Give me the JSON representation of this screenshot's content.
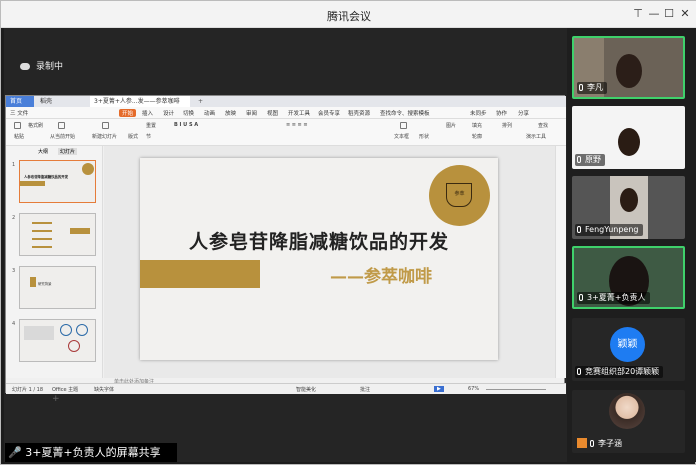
{
  "app": {
    "title": "腾讯会议"
  },
  "recording": {
    "label": "录制中"
  },
  "share_banner": {
    "label": "3+夏菁+负责人的屏幕共享"
  },
  "ppt": {
    "tabs": [
      "首页",
      "稻壳",
      "3+夏菁+人参...发——参萃咖啡"
    ],
    "menu": [
      "三 文件",
      "开始",
      "插入",
      "设计",
      "切换",
      "动画",
      "放映",
      "审阅",
      "视图",
      "开发工具",
      "会员专享",
      "稻壳资源",
      "查找命令、搜索模板",
      "未同步",
      "协作",
      "分享"
    ],
    "ribbon": [
      "格式刷",
      "粘贴",
      "从当前开始",
      "新建幻灯片",
      "版式",
      "节",
      "重置",
      "文本框",
      "形状",
      "图片",
      "填充",
      "轮廓",
      "排列",
      "演示工具",
      "查找",
      "替换"
    ],
    "thumb_tabs": [
      "大纲",
      "幻灯片"
    ],
    "thumbs": [
      {
        "num": "1",
        "text": "人参皂苷降脂减糖饮品的开发"
      },
      {
        "num": "2",
        "text": ""
      },
      {
        "num": "3",
        "text": "研究背景"
      },
      {
        "num": "4",
        "text": ""
      }
    ],
    "slide": {
      "title": "人参皂苷降脂减糖饮品的开发",
      "subtitle": "——参萃咖啡",
      "logo_label": "参萃"
    },
    "notes": "单击此处添加备注",
    "status": {
      "page": "幻灯片 1 / 18",
      "theme": "Office 主题",
      "font": "缺失字体",
      "notes": "智能美化",
      "comment": "批注",
      "zoom": "67%"
    }
  },
  "participants": [
    {
      "name": "李凡",
      "active": true,
      "kind": "video"
    },
    {
      "name": "原野",
      "active": false,
      "kind": "video"
    },
    {
      "name": "FengYunpeng",
      "active": false,
      "kind": "video"
    },
    {
      "name": "3+夏菁+负责人",
      "active": true,
      "kind": "video"
    },
    {
      "name": "竞赛组织部20谭颖颖",
      "active": false,
      "kind": "avatar",
      "avatar_text": "颖颖"
    },
    {
      "name": "李子涵",
      "active": false,
      "kind": "photo"
    }
  ]
}
